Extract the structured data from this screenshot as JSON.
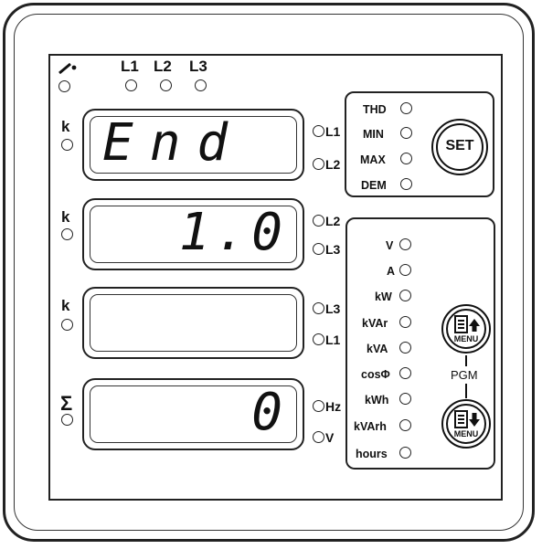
{
  "top_indicators": {
    "breaker_icon": "breaker-icon",
    "phases": [
      "L1",
      "L2",
      "L3"
    ]
  },
  "rows": [
    {
      "prefix": "k",
      "value": "End",
      "side_labels": [
        "L1",
        "L2"
      ]
    },
    {
      "prefix": "k",
      "value": "1.0",
      "side_labels": [
        "L2",
        "L3"
      ]
    },
    {
      "prefix": "k",
      "value": "",
      "side_labels": [
        "L3",
        "L1"
      ]
    },
    {
      "prefix": "Σ",
      "value": "0",
      "side_labels": [
        "Hz",
        "V"
      ]
    }
  ],
  "function_leds": [
    "THD",
    "MIN",
    "MAX",
    "DEM"
  ],
  "set_button": {
    "label": "SET"
  },
  "unit_leds": [
    "V",
    "A",
    "kW",
    "kVAr",
    "kVA",
    "cosΦ",
    "kWh",
    "kVArh",
    "hours"
  ],
  "menu_up": {
    "label": "MENU",
    "icon": "menu-up-icon"
  },
  "menu_down": {
    "label": "MENU",
    "icon": "menu-down-icon"
  },
  "pgm_label": "PGM"
}
